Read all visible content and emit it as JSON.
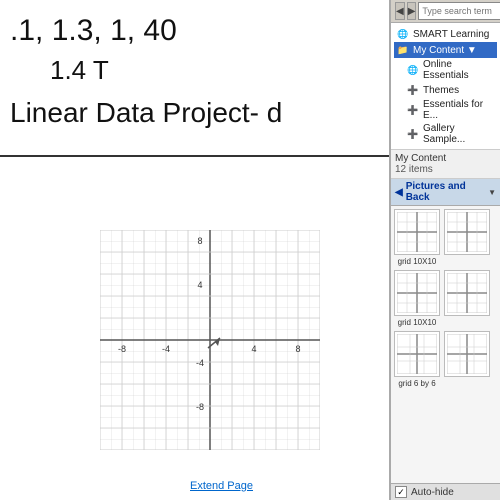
{
  "whiteboard": {
    "line1": ".1, 1.3, 1, 40",
    "line2": "1.4 T",
    "line3": "Linear Data Project- d",
    "extend_link": "Extend Page"
  },
  "sidebar": {
    "search_placeholder": "Type search term",
    "tree": {
      "items": [
        {
          "label": "SMART Learning",
          "indent": 0,
          "icon": "globe",
          "expanded": false
        },
        {
          "label": "My Content ▼",
          "indent": 0,
          "icon": "folder",
          "selected": true
        },
        {
          "label": "Online Essentials",
          "indent": 1,
          "icon": "globe"
        },
        {
          "label": "Themes",
          "indent": 1,
          "icon": "folder"
        },
        {
          "label": "Essentials for E...",
          "indent": 1,
          "icon": "folder"
        },
        {
          "label": "Gallery Sample...",
          "indent": 1,
          "icon": "folder"
        }
      ]
    },
    "content_header": "My Content",
    "content_count": "12 items",
    "section_label": "Pictures and Back",
    "thumbnails": [
      {
        "label": "grid 10X10",
        "type": "grid10"
      },
      {
        "label": "",
        "type": "grid10b"
      },
      {
        "label": "grid 10X10",
        "type": "grid10"
      },
      {
        "label": "",
        "type": "grid10b"
      },
      {
        "label": "grid 6 by 6",
        "type": "grid6"
      },
      {
        "label": "",
        "type": "grid6b"
      }
    ],
    "auto_hide_label": "Auto-hide",
    "auto_hide_checked": true
  }
}
